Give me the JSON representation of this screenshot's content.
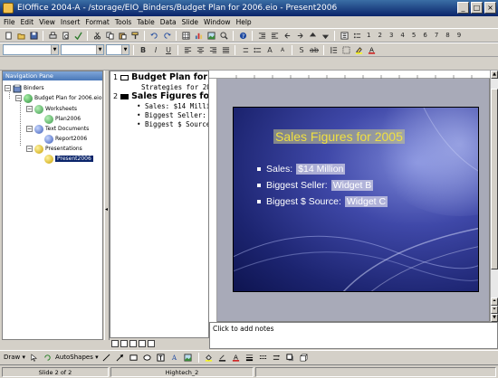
{
  "window": {
    "title": "EIOffice 2004-A - /storage/EIO_Binders/Budget Plan for 2006.eio - Present2006",
    "minimize_glyph": "_",
    "maximize_glyph": "□",
    "close_glyph": "×"
  },
  "menu": [
    "File",
    "Edit",
    "View",
    "Insert",
    "Format",
    "Tools",
    "Table",
    "Data",
    "Slide",
    "Window",
    "Help"
  ],
  "toolbar2": {
    "numbers": [
      "1",
      "2",
      "3",
      "4",
      "5",
      "6",
      "7",
      "8",
      "9"
    ]
  },
  "nav": {
    "header": "Navigation Pane",
    "root": "Binders",
    "binder": "Budget Plan for 2006.eio",
    "worksheets": "Worksheets",
    "plan": "Plan2006",
    "textdocs": "Text Documents",
    "report": "Report2006",
    "presentations": "Presentations",
    "present": "Present2006"
  },
  "outline": {
    "slide1_num": "1",
    "slide1_title": "Budget Plan for",
    "slide1_sub": "Strategies for 20",
    "slide2_num": "2",
    "slide2_title": "Sales Figures fo",
    "bullets": [
      "• Sales: $14 Millio",
      "• Biggest Seller: W",
      "• Biggest $ Source:"
    ]
  },
  "slide": {
    "title": "Sales Figures for 2005",
    "bullets": [
      {
        "label": "Sales:",
        "value": "$14 Million"
      },
      {
        "label": "Biggest Seller:",
        "value": "Widget B"
      },
      {
        "label": "Biggest $ Source:",
        "value": "Widget C"
      }
    ],
    "colors": {
      "title": "#f0e040",
      "bg_dark": "#1c2470",
      "bg_light": "#7d88d8"
    }
  },
  "notes": {
    "placeholder": "Click to add notes"
  },
  "drawbar": {
    "draw": "Draw ▾",
    "autoshapes": "AutoShapes ▾"
  },
  "status": {
    "slide": "Slide 2 of 2",
    "template": "Hightech_2"
  }
}
